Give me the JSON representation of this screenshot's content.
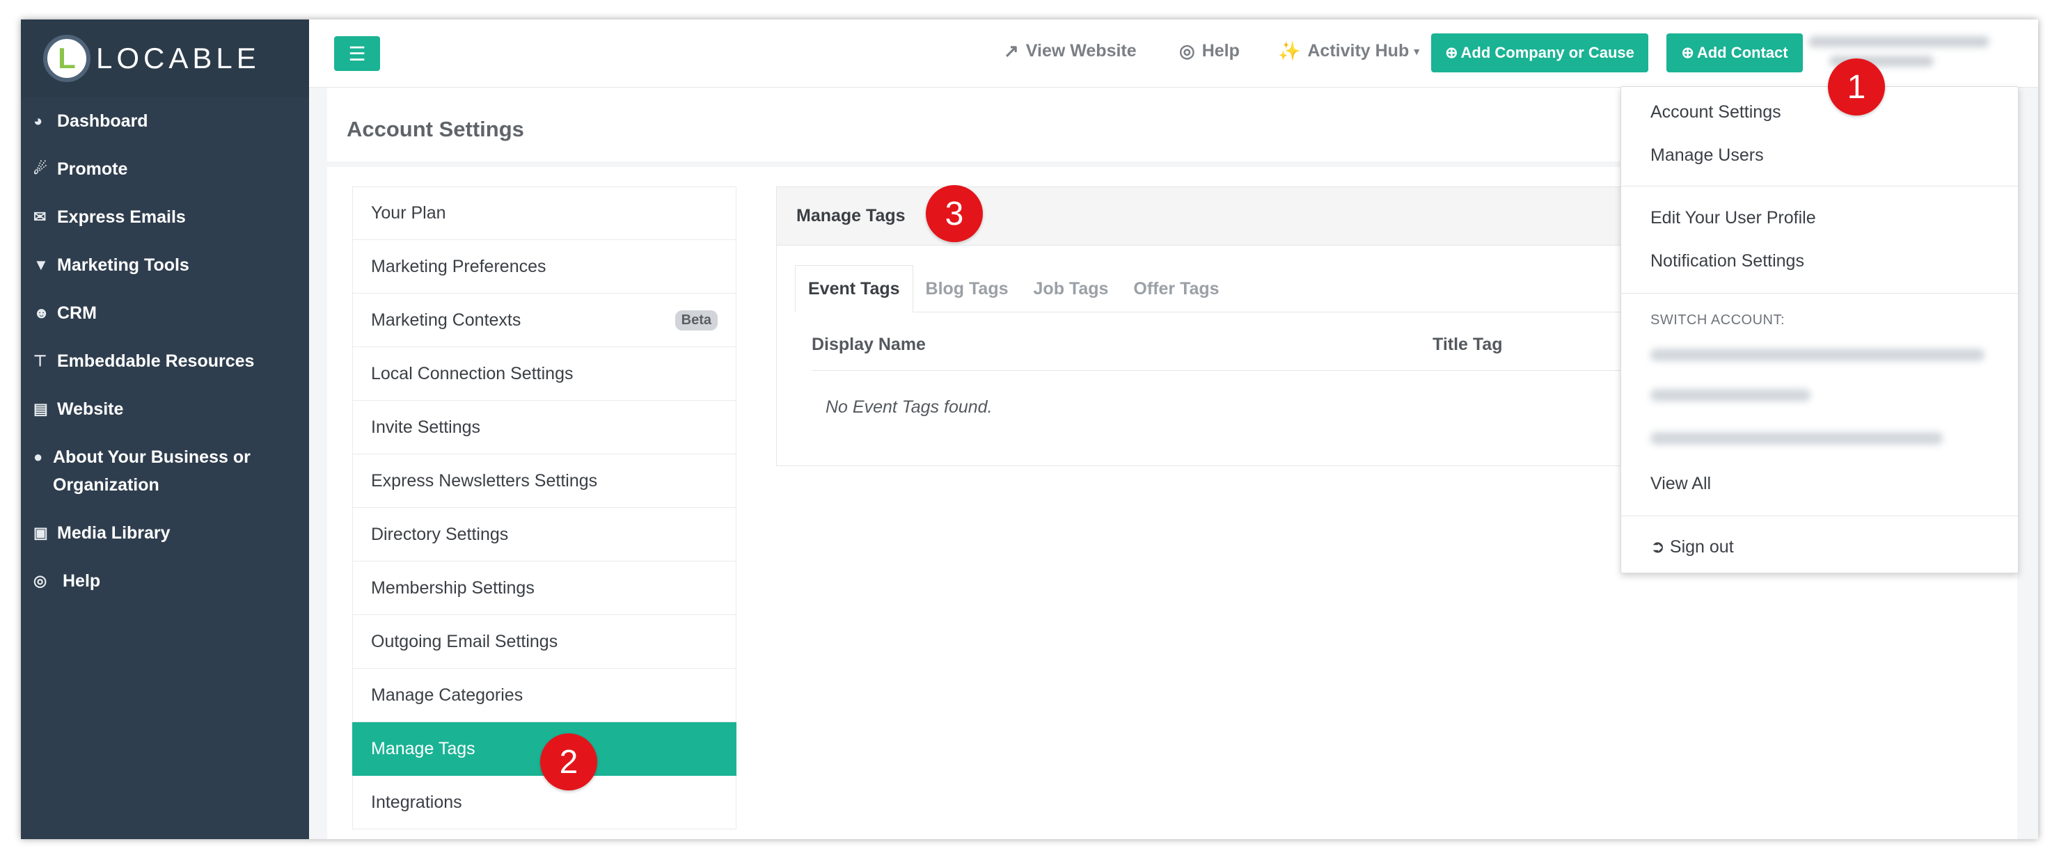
{
  "brand": {
    "name": "LOCABLE",
    "logo_letter": "L"
  },
  "sidebar": {
    "items": [
      {
        "label": "Dashboard",
        "icon": "dashboard-gauge-icon"
      },
      {
        "label": "Promote",
        "icon": "megaphone-icon"
      },
      {
        "label": "Express Emails",
        "icon": "envelope-icon"
      },
      {
        "label": "Marketing Tools",
        "icon": "filter-funnel-icon"
      },
      {
        "label": "CRM",
        "icon": "users-icon"
      },
      {
        "label": "Embeddable Resources",
        "icon": "signpost-icon"
      },
      {
        "label": "Website",
        "icon": "desktop-icon"
      },
      {
        "label": "About Your Business or Organization",
        "icon": "map-pin-icon"
      },
      {
        "label": "Media Library",
        "icon": "image-icon"
      },
      {
        "label": "Help",
        "icon": "life-ring-icon"
      }
    ]
  },
  "topbar": {
    "view_website": "View Website",
    "help": "Help",
    "activity_hub": "Activity Hub",
    "add_company": "Add Company or Cause",
    "add_contact": "Add Contact"
  },
  "page": {
    "title": "Account Settings"
  },
  "settings_list": [
    {
      "label": "Your Plan"
    },
    {
      "label": "Marketing Preferences"
    },
    {
      "label": "Marketing Contexts",
      "badge": "Beta"
    },
    {
      "label": "Local Connection Settings"
    },
    {
      "label": "Invite Settings"
    },
    {
      "label": "Express Newsletters Settings"
    },
    {
      "label": "Directory Settings"
    },
    {
      "label": "Membership Settings"
    },
    {
      "label": "Outgoing Email Settings"
    },
    {
      "label": "Manage Categories"
    },
    {
      "label": "Manage Tags",
      "active": true
    },
    {
      "label": "Integrations"
    }
  ],
  "panel": {
    "title": "Manage Tags",
    "tabs": [
      "Event Tags",
      "Blog Tags",
      "Job Tags",
      "Offer Tags"
    ],
    "active_tab": "Event Tags",
    "columns": [
      "Display Name",
      "Title Tag"
    ],
    "empty_message": "No Event Tags found."
  },
  "dropdown": {
    "account_settings": "Account Settings",
    "manage_users": "Manage Users",
    "edit_profile": "Edit Your User Profile",
    "notification_settings": "Notification Settings",
    "switch_account_header": "SWITCH ACCOUNT:",
    "view_all": "View All",
    "sign_out": "Sign out"
  },
  "callouts": [
    "1",
    "2",
    "3"
  ],
  "colors": {
    "accent": "#1ab394",
    "sidebar": "#2f3e4e",
    "callout": "#e3151a"
  }
}
